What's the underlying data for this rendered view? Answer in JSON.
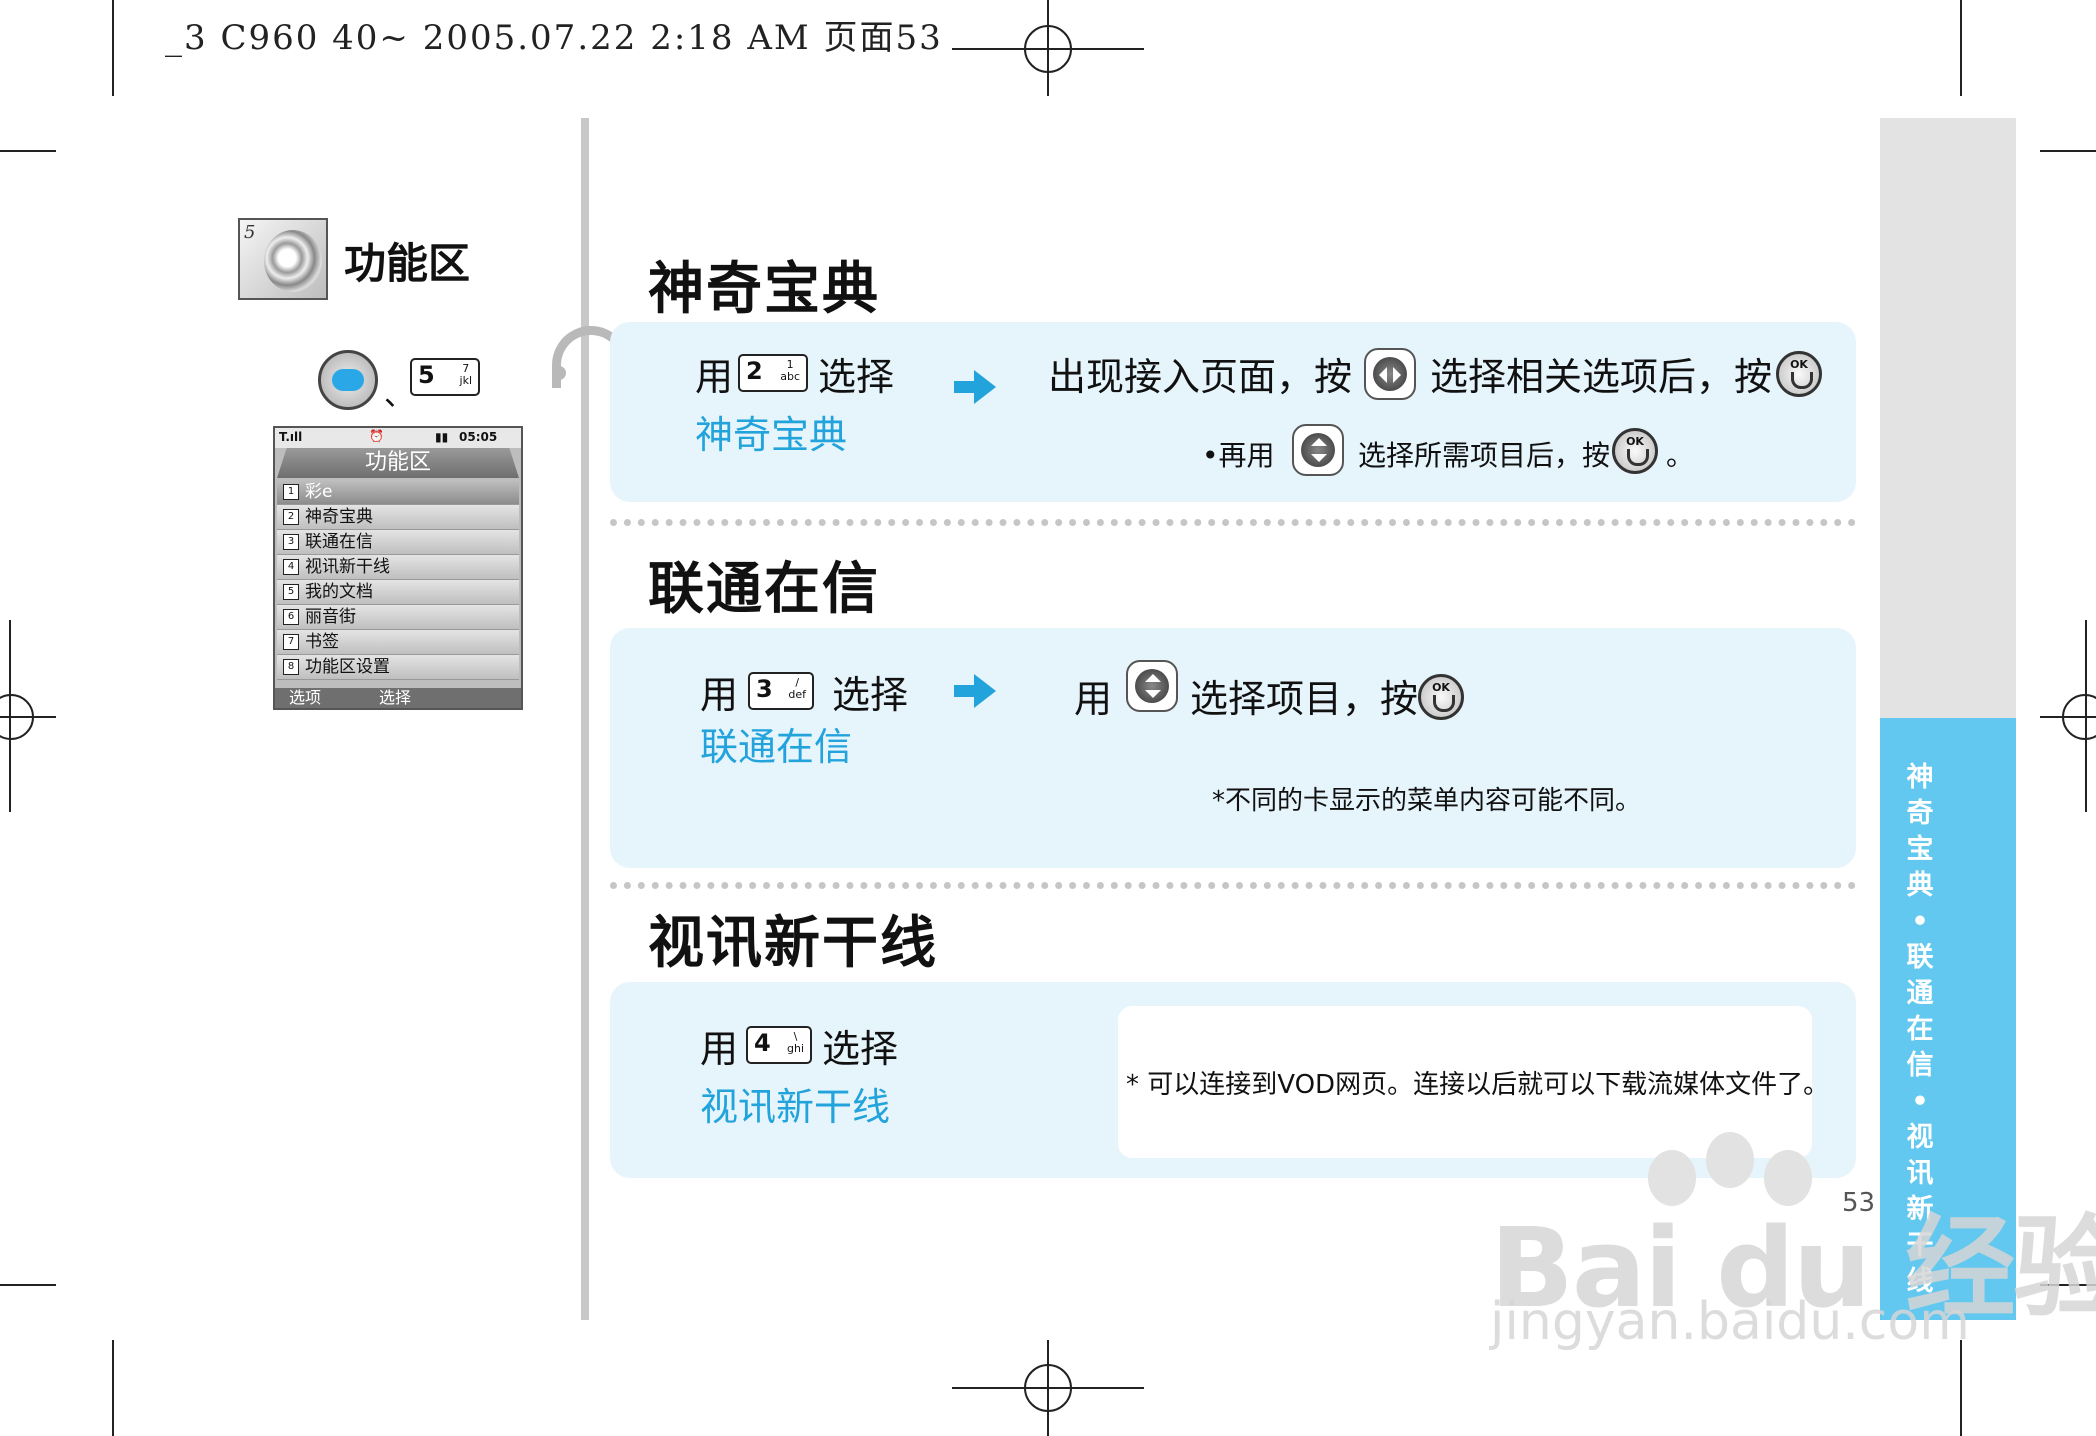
{
  "header": {
    "text": "_3 C960 40~ 2005.07.22 2:18 AM 页面53"
  },
  "chapter": {
    "number": "5",
    "title": "功能区"
  },
  "shortcut": {
    "separator": "、",
    "key_digit": "5",
    "key_sub": "7\njkl"
  },
  "phone": {
    "title": "功能区",
    "time": "05:05",
    "items": [
      {
        "num": "1",
        "label": "彩e"
      },
      {
        "num": "2",
        "label": "神奇宝典"
      },
      {
        "num": "3",
        "label": "联通在信"
      },
      {
        "num": "4",
        "label": "视讯新干线"
      },
      {
        "num": "5",
        "label": "我的文档"
      },
      {
        "num": "6",
        "label": "丽音街"
      },
      {
        "num": "7",
        "label": "书签"
      },
      {
        "num": "8",
        "label": "功能区设置"
      }
    ],
    "soft_left": "选项",
    "soft_right": "选择"
  },
  "sections": [
    {
      "title": "神奇宝典",
      "use": "用",
      "key_digit": "2",
      "key_sub": "1\nabc",
      "select": "选择",
      "name": "神奇宝典",
      "step_a": "出现接入页面，按",
      "step_b": "选择相关选项后，按",
      "note_prefix": "•再用",
      "note_middle": "选择所需项目后，按",
      "note_end": "。"
    },
    {
      "title": "联通在信",
      "use": "用",
      "key_digit": "3",
      "key_sub": "/\ndef",
      "select": "选择",
      "name": "联通在信",
      "step_a": "用",
      "step_b": "选择项目，按",
      "note": "*不同的卡显示的菜单内容可能不同。"
    },
    {
      "title": "视讯新干线",
      "use": "用",
      "key_digit": "4",
      "key_sub": "\\\nghi",
      "select": "选择",
      "name": "视讯新干线",
      "note": "* 可以连接到VOD网页。连接以后就可以下载流媒体文件了。"
    }
  ],
  "side_tab": "神奇宝典•联通在信•视讯新干线",
  "page_number": "53",
  "ok_label": "OK",
  "watermark": {
    "brand": "Bai du 经验",
    "url": "jingyan.baidu.com"
  },
  "colors": {
    "accent": "#22a3dc",
    "panel": "#e6f4fb",
    "side_tab": "#62c8ef"
  }
}
